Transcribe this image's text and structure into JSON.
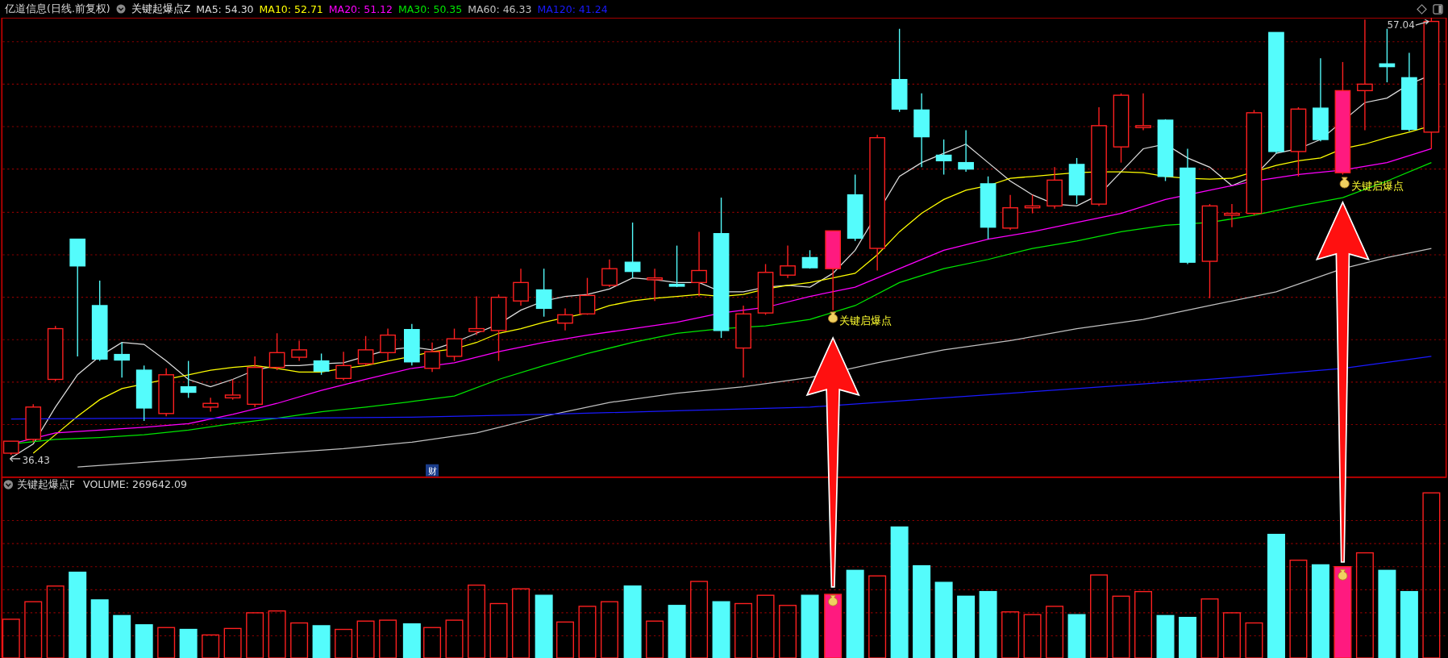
{
  "window": {
    "title": "亿道信息(日线.前复权)"
  },
  "main_indicator": {
    "name": "关键起爆点Z",
    "moving_averages": [
      {
        "label": "MA5: 54.30",
        "color": "#dcdcdc"
      },
      {
        "label": "MA10: 52.71",
        "color": "#ffff00"
      },
      {
        "label": "MA20: 51.12",
        "color": "#ff00ff"
      },
      {
        "label": "MA30: 50.35",
        "color": "#00e600"
      },
      {
        "label": "MA60: 46.33",
        "color": "#c0c0c0"
      },
      {
        "label": "MA120: 41.24",
        "color": "#1a1aff"
      }
    ]
  },
  "price_labels": {
    "high": "57.04",
    "low": "36.43"
  },
  "signals": [
    {
      "label": "关键启爆点"
    },
    {
      "label": "关键启爆点"
    }
  ],
  "finance_badge": "财",
  "volume_indicator": {
    "name": "关键起爆点F",
    "label": "VOLUME: 269642.09"
  }
}
